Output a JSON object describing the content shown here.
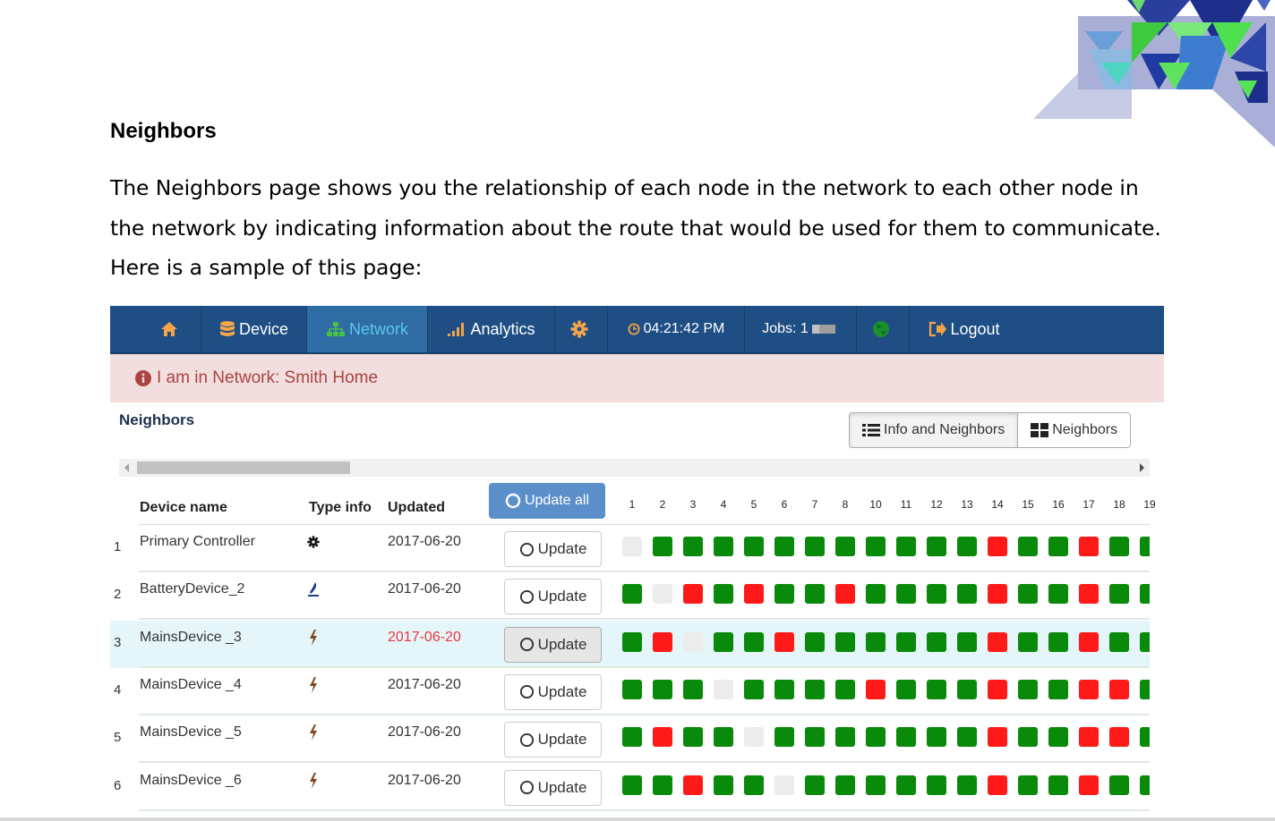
{
  "document": {
    "heading": "Neighbors",
    "paragraph": "The Neighbors page shows you the relationship of each node in the network to each other node in the network by indicating information about the route that would be used for them to communicate.  Here is a sample of this page:"
  },
  "navbar": {
    "home_icon": "home-icon",
    "device": "Device",
    "network": "Network",
    "analytics": "Analytics",
    "settings_icon": "gear-icon",
    "clock": "04:21:42 PM",
    "jobs": "Jobs: 1",
    "globe_icon": "globe-icon",
    "logout": "Logout"
  },
  "alert": {
    "text": "I am in Network: Smith Home"
  },
  "section": {
    "title": "Neighbors",
    "info_button": "Info and Neighbors",
    "neighbors_button": "Neighbors"
  },
  "table": {
    "headers": {
      "device_name": "Device name",
      "type_info": "Type info",
      "updated": "Updated"
    },
    "update_all": "Update all",
    "update_label": "Update",
    "columns": [
      "1",
      "2",
      "3",
      "4",
      "5",
      "6",
      "7",
      "8",
      "10",
      "11",
      "12",
      "13",
      "14",
      "15",
      "16",
      "17",
      "18",
      "19"
    ],
    "rows": [
      {
        "num": "1",
        "name": "Primary Controller",
        "type": "gear-icon",
        "date": "2017-06-20",
        "date_red": false,
        "highlight": false,
        "cells": [
          "E",
          "G",
          "G",
          "G",
          "G",
          "G",
          "G",
          "G",
          "G",
          "G",
          "G",
          "G",
          "R",
          "G",
          "G",
          "R",
          "G",
          "G"
        ]
      },
      {
        "num": "2",
        "name": "BatteryDevice_2",
        "type": "battery-icon",
        "date": "2017-06-20",
        "date_red": false,
        "highlight": false,
        "cells": [
          "G",
          "E",
          "R",
          "G",
          "R",
          "G",
          "G",
          "R",
          "G",
          "G",
          "G",
          "G",
          "R",
          "G",
          "G",
          "R",
          "G",
          "G"
        ]
      },
      {
        "num": "3",
        "name": "MainsDevice _3",
        "type": "bolt-icon",
        "date": "2017-06-20",
        "date_red": true,
        "highlight": true,
        "cells": [
          "G",
          "R",
          "E",
          "G",
          "G",
          "R",
          "G",
          "G",
          "G",
          "G",
          "G",
          "G",
          "R",
          "G",
          "G",
          "R",
          "G",
          "G"
        ]
      },
      {
        "num": "4",
        "name": "MainsDevice _4",
        "type": "bolt-icon",
        "date": "2017-06-20",
        "date_red": false,
        "highlight": false,
        "cells": [
          "G",
          "G",
          "G",
          "E",
          "G",
          "G",
          "G",
          "G",
          "R",
          "G",
          "G",
          "G",
          "R",
          "G",
          "G",
          "R",
          "R",
          "G"
        ]
      },
      {
        "num": "5",
        "name": "MainsDevice _5",
        "type": "bolt-icon",
        "date": "2017-06-20",
        "date_red": false,
        "highlight": false,
        "cells": [
          "G",
          "R",
          "G",
          "G",
          "E",
          "G",
          "G",
          "G",
          "G",
          "G",
          "G",
          "G",
          "R",
          "G",
          "G",
          "R",
          "R",
          "G"
        ]
      },
      {
        "num": "6",
        "name": "MainsDevice _6",
        "type": "bolt-icon",
        "date": "2017-06-20",
        "date_red": false,
        "highlight": false,
        "cells": [
          "G",
          "G",
          "R",
          "G",
          "G",
          "E",
          "G",
          "G",
          "G",
          "G",
          "G",
          "G",
          "R",
          "G",
          "G",
          "R",
          "G",
          "G"
        ]
      }
    ]
  },
  "colors": {
    "green": "#0a8a0a",
    "red": "#ff1a1a",
    "empty": "#ececec",
    "navbar": "#1e4e84",
    "alert_bg": "#f2dede"
  }
}
